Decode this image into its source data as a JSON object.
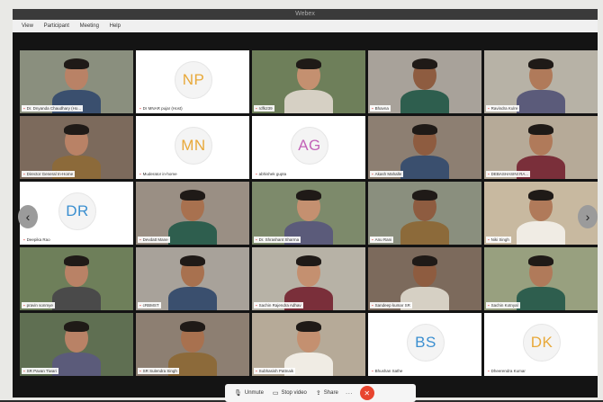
{
  "app": {
    "title": "Webex",
    "menu": [
      "View",
      "Participant",
      "Meeting",
      "Help"
    ]
  },
  "participants": [
    {
      "name": "Dr. Dnyanda Chaudhary (Ho...",
      "video": true
    },
    {
      "name": "Dr MNAR pujar (Host)",
      "initials": "NP",
      "color": "#e8a93a"
    },
    {
      "name": "rdfk239",
      "video": true
    },
    {
      "name": "Bhavna",
      "video": true
    },
    {
      "name": "Ravindra Kulre",
      "video": true
    },
    {
      "name": "Director General In-Home",
      "video": true
    },
    {
      "name": "Muderator in-home",
      "initials": "MN",
      "color": "#e8a93a"
    },
    {
      "name": "abhishek gupta",
      "initials": "AG",
      "color": "#c262b8"
    },
    {
      "name": "Akash Mahalle",
      "video": true
    },
    {
      "name": "DEBASHASINI RA...",
      "video": true
    },
    {
      "name": "Deepika Rao",
      "initials": "DR",
      "color": "#3b8fd0"
    },
    {
      "name": "Devdatt Mane",
      "video": true
    },
    {
      "name": "Dr. Shrashant Sharma",
      "video": true
    },
    {
      "name": "Anu Rani",
      "video": true
    },
    {
      "name": "Niki Singh",
      "video": true
    },
    {
      "name": "pravin sonmye",
      "video": true
    },
    {
      "name": "cRBMST",
      "video": true
    },
    {
      "name": "Sachin Rajendra Adhav",
      "video": true
    },
    {
      "name": "Sandeep kumar SR",
      "video": true
    },
    {
      "name": "Sachin Kotnyal",
      "video": true
    },
    {
      "name": "SR Pavan Tiwari",
      "video": true
    },
    {
      "name": "SR Sulendra Singh",
      "video": true
    },
    {
      "name": "Subhasish Pattnaik",
      "video": true
    },
    {
      "name": "Bhushan Sathe",
      "initials": "BS",
      "color": "#3b8fd0"
    },
    {
      "name": "Dheerendra Kumar",
      "initials": "DK",
      "color": "#e8a93a"
    }
  ],
  "toolbar": {
    "unmute": "Unmute",
    "stop_video": "Stop video",
    "share": "Share",
    "more": "···"
  },
  "nav": {
    "prev": "‹",
    "next": "›"
  }
}
